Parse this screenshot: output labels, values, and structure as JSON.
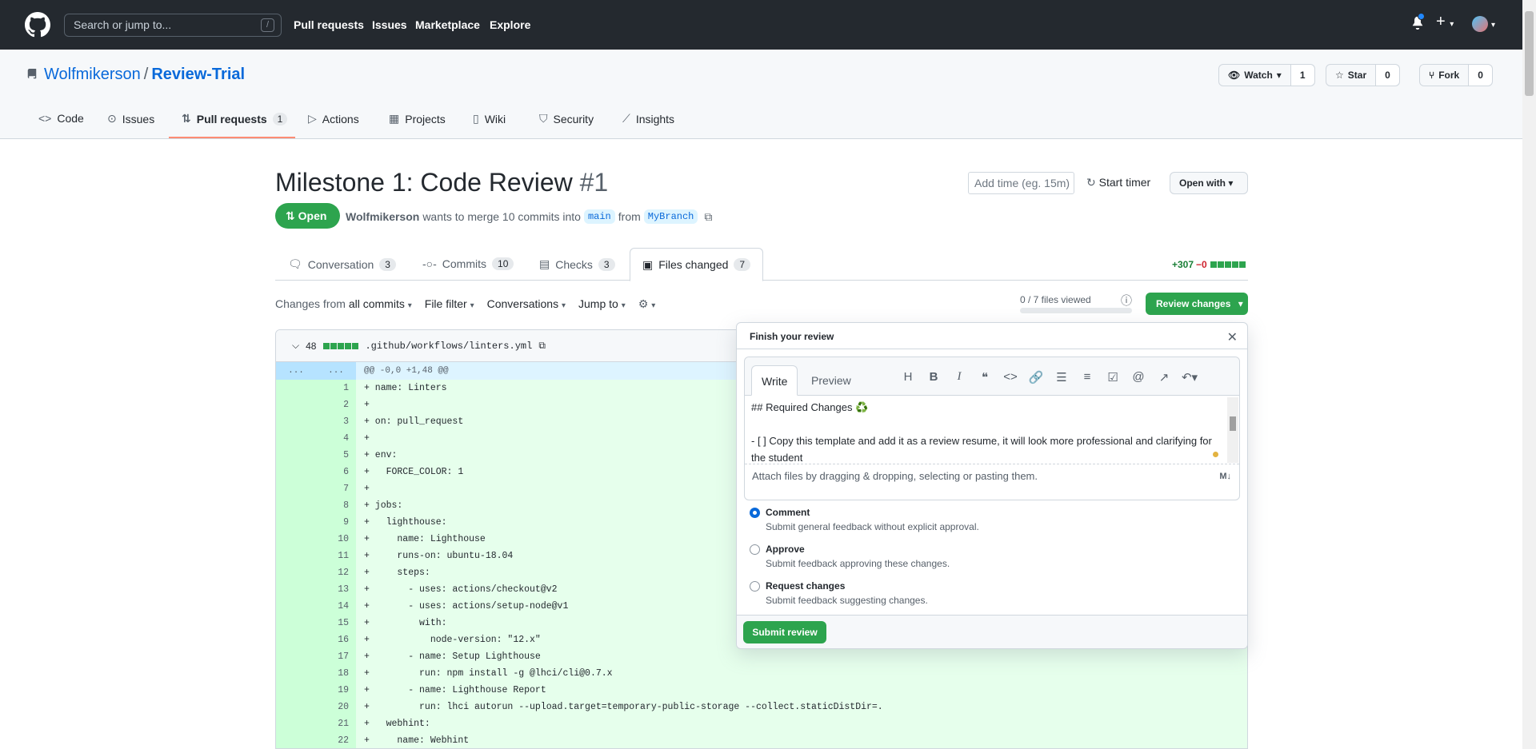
{
  "header": {
    "search_placeholder": "Search or jump to...",
    "search_shortcut": "/",
    "nav": [
      "Pull requests",
      "Issues",
      "Marketplace",
      "Explore"
    ]
  },
  "repo": {
    "owner": "Wolfmikerson",
    "separator": "/",
    "name": "Review-Trial",
    "watch_label": "Watch",
    "watch_count": "1",
    "star_label": "Star",
    "star_count": "0",
    "fork_label": "Fork",
    "fork_count": "0",
    "tabs": [
      {
        "label": "Code"
      },
      {
        "label": "Issues"
      },
      {
        "label": "Pull requests",
        "count": "1"
      },
      {
        "label": "Actions"
      },
      {
        "label": "Projects"
      },
      {
        "label": "Wiki"
      },
      {
        "label": "Security"
      },
      {
        "label": "Insights"
      }
    ]
  },
  "pr": {
    "title": "Milestone 1: Code Review",
    "number": "#1",
    "state": "Open",
    "author": "Wolfmikerson",
    "merge_text": "wants to merge 10 commits into",
    "base": "main",
    "from_text": "from",
    "head": "MyBranch",
    "time_placeholder": "Add time (eg. 15m)",
    "start_timer": "Start timer",
    "open_with": "Open with",
    "tabs": [
      {
        "label": "Conversation",
        "count": "3"
      },
      {
        "label": "Commits",
        "count": "10"
      },
      {
        "label": "Checks",
        "count": "3"
      },
      {
        "label": "Files changed",
        "count": "7"
      }
    ],
    "additions": "+307",
    "deletions": "−0"
  },
  "toolbar": {
    "changes_from": "Changes from",
    "all_commits": "all commits",
    "file_filter": "File filter",
    "conversations": "Conversations",
    "jump_to": "Jump to",
    "files_viewed": "0 / 7 files viewed",
    "review_changes": "Review changes"
  },
  "diff": {
    "changes_count": "48",
    "filename": ".github/workflows/linters.yml",
    "hunk_left": "...",
    "hunk_right": "...",
    "hunk_header": "@@ -0,0 +1,48 @@",
    "lines": [
      {
        "n": "1",
        "t": "+ name: Linters"
      },
      {
        "n": "2",
        "t": "+"
      },
      {
        "n": "3",
        "t": "+ on: pull_request"
      },
      {
        "n": "4",
        "t": "+"
      },
      {
        "n": "5",
        "t": "+ env:"
      },
      {
        "n": "6",
        "t": "+   FORCE_COLOR: 1"
      },
      {
        "n": "7",
        "t": "+"
      },
      {
        "n": "8",
        "t": "+ jobs:"
      },
      {
        "n": "9",
        "t": "+   lighthouse:"
      },
      {
        "n": "10",
        "t": "+     name: Lighthouse"
      },
      {
        "n": "11",
        "t": "+     runs-on: ubuntu-18.04"
      },
      {
        "n": "12",
        "t": "+     steps:"
      },
      {
        "n": "13",
        "t": "+       - uses: actions/checkout@v2"
      },
      {
        "n": "14",
        "t": "+       - uses: actions/setup-node@v1"
      },
      {
        "n": "15",
        "t": "+         with:"
      },
      {
        "n": "16",
        "t": "+           node-version: \"12.x\""
      },
      {
        "n": "17",
        "t": "+       - name: Setup Lighthouse"
      },
      {
        "n": "18",
        "t": "+         run: npm install -g @lhci/cli@0.7.x"
      },
      {
        "n": "19",
        "t": "+       - name: Lighthouse Report"
      },
      {
        "n": "20",
        "t": "+         run: lhci autorun --upload.target=temporary-public-storage --collect.staticDistDir=."
      },
      {
        "n": "21",
        "t": "+   webhint:"
      },
      {
        "n": "22",
        "t": "+     name: Webhint"
      }
    ]
  },
  "review": {
    "title": "Finish your review",
    "write_tab": "Write",
    "preview_tab": "Preview",
    "body_line1": "## Required Changes ♻️",
    "body_line2": "- [ ] Copy this template and add it as a review resume, it will look more professional and clarifying for the student",
    "attach_text": "Attach files by dragging & dropping, selecting or pasting them.",
    "options": [
      {
        "label": "Comment",
        "desc": "Submit general feedback without explicit approval.",
        "selected": true
      },
      {
        "label": "Approve",
        "desc": "Submit feedback approving these changes.",
        "selected": false
      },
      {
        "label": "Request changes",
        "desc": "Submit feedback suggesting changes.",
        "selected": false
      }
    ],
    "submit": "Submit review"
  }
}
